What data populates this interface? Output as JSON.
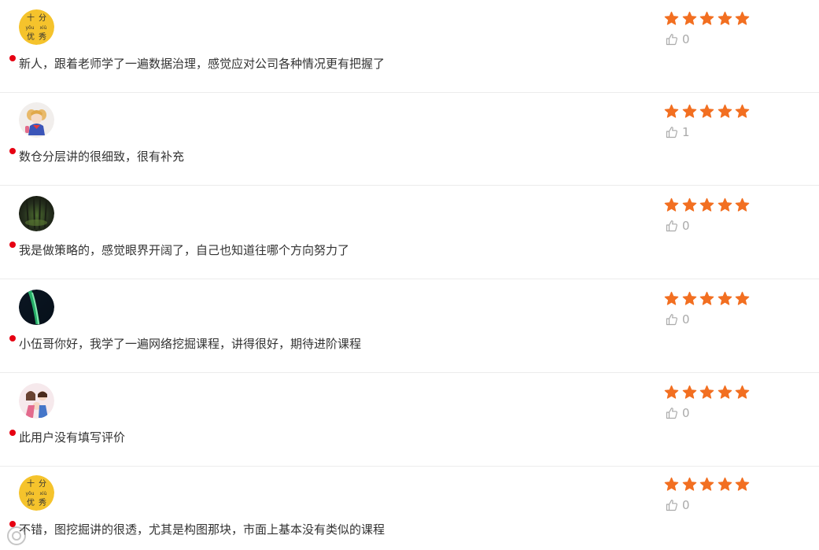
{
  "colors": {
    "star": "#f26f21",
    "dot": "#e60012",
    "like": "#aaaaaa",
    "text": "#333333",
    "divider": "#ececec"
  },
  "icons": {
    "star": "star-icon",
    "like": "thumbs-up-icon",
    "dot": "bullet-dot"
  },
  "reviews": [
    {
      "avatar_style": "youxiu-badge",
      "avatar_text": [
        "十",
        "分",
        "yōu",
        "xiù",
        "优",
        "秀"
      ],
      "rating": 5,
      "likes": "0",
      "comment": "新人，跟着老师学了一遍数据治理，感觉应对公司各种情况更有把握了"
    },
    {
      "avatar_style": "anime-girl",
      "rating": 5,
      "likes": "1",
      "comment": "数仓分层讲的很细致，很有补充"
    },
    {
      "avatar_style": "dark-forest",
      "rating": 5,
      "likes": "0",
      "comment": "我是做策略的，感觉眼界开阔了，自己也知道往哪个方向努力了"
    },
    {
      "avatar_style": "aurora",
      "rating": 5,
      "likes": "0",
      "comment": "小伍哥你好，我学了一遍网络挖掘课程，讲得很好，期待进阶课程"
    },
    {
      "avatar_style": "cartoon-family",
      "rating": 5,
      "likes": "0",
      "comment": "此用户没有填写评价"
    },
    {
      "avatar_style": "youxiu-badge",
      "avatar_text": [
        "十",
        "分",
        "yōu",
        "xiù",
        "优",
        "秀"
      ],
      "rating": 5,
      "likes": "0",
      "comment": "不错，图挖掘讲的很透，尤其是构图那块，市面上基本没有类似的课程"
    }
  ]
}
